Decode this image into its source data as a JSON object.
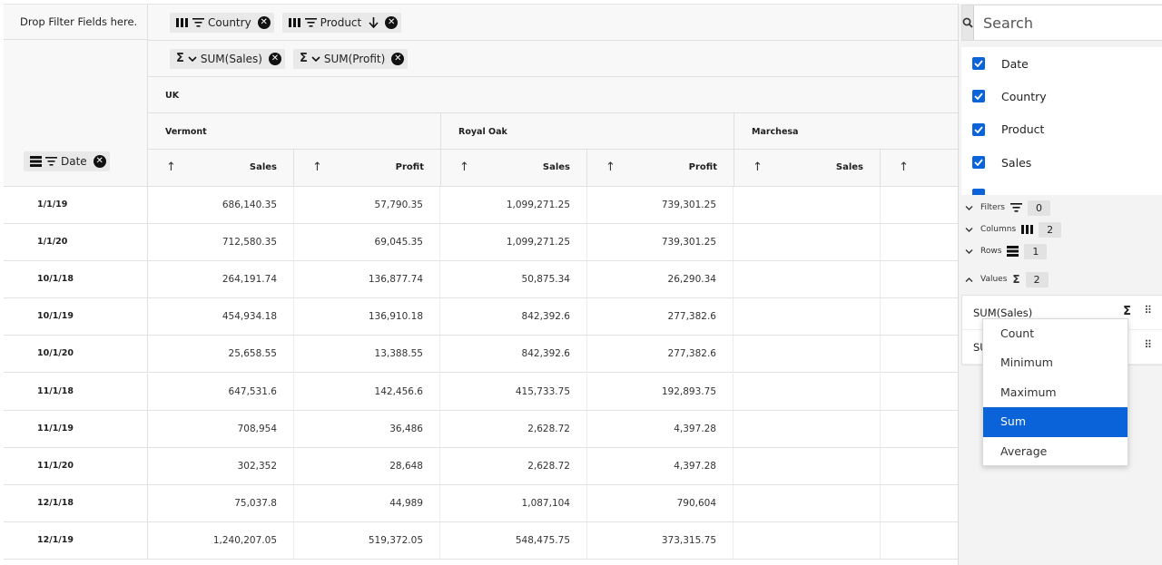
{
  "grid": {
    "filter_drop_text": "Drop Filter Fields here.",
    "column_chips": [
      {
        "label": "Country",
        "sort_icon": "none"
      },
      {
        "label": "Product",
        "sort_icon": "arrow-down-icon"
      }
    ],
    "value_chips": [
      {
        "label": "SUM(Sales)"
      },
      {
        "label": "SUM(Profit)"
      }
    ],
    "row_chip": {
      "label": "Date"
    },
    "country_header": "UK",
    "product_headers": [
      "Vermont",
      "Royal Oak",
      "Marchesa"
    ],
    "measure_headers": [
      "Sales",
      "Profit",
      "Sales",
      "Profit",
      "Sales",
      ""
    ],
    "sort_arrow_glyph": "↑",
    "rows": [
      {
        "date": "1/1/19",
        "values": [
          "686,140.35",
          "57,790.35",
          "1,099,271.25",
          "739,301.25",
          "",
          ""
        ]
      },
      {
        "date": "1/1/20",
        "values": [
          "712,580.35",
          "69,045.35",
          "1,099,271.25",
          "739,301.25",
          "",
          ""
        ]
      },
      {
        "date": "10/1/18",
        "values": [
          "264,191.74",
          "136,877.74",
          "50,875.34",
          "26,290.34",
          "",
          ""
        ]
      },
      {
        "date": "10/1/19",
        "values": [
          "454,934.18",
          "136,910.18",
          "842,392.6",
          "277,382.6",
          "",
          ""
        ]
      },
      {
        "date": "10/1/20",
        "values": [
          "25,658.55",
          "13,388.55",
          "842,392.6",
          "277,382.6",
          "",
          ""
        ]
      },
      {
        "date": "11/1/18",
        "values": [
          "647,531.6",
          "142,456.6",
          "415,733.75",
          "192,893.75",
          "",
          ""
        ]
      },
      {
        "date": "11/1/19",
        "values": [
          "708,954",
          "36,486",
          "2,628.72",
          "4,397.28",
          "",
          ""
        ]
      },
      {
        "date": "11/1/20",
        "values": [
          "302,352",
          "28,648",
          "2,628.72",
          "4,397.28",
          "",
          ""
        ]
      },
      {
        "date": "12/1/18",
        "values": [
          "75,037.8",
          "44,989",
          "1,087,104",
          "790,604",
          "",
          ""
        ]
      },
      {
        "date": "12/1/19",
        "values": [
          "1,240,207.05",
          "519,372.05",
          "548,475.75",
          "373,315.75",
          "",
          ""
        ]
      }
    ]
  },
  "chooser": {
    "search_placeholder": "Search",
    "fields": [
      {
        "label": "Date",
        "checked": true
      },
      {
        "label": "Country",
        "checked": true
      },
      {
        "label": "Product",
        "checked": true
      },
      {
        "label": "Sales",
        "checked": true
      }
    ],
    "sections": [
      {
        "label": "Filters",
        "count": "0",
        "icon": "filter-icon",
        "expanded": false
      },
      {
        "label": "Columns",
        "count": "2",
        "icon": "columns-icon",
        "expanded": false
      },
      {
        "label": "Rows",
        "count": "1",
        "icon": "rows-icon",
        "expanded": false
      },
      {
        "label": "Values",
        "count": "2",
        "icon": "sigma-icon",
        "expanded": true
      }
    ],
    "values": [
      {
        "label": "SUM(Sales)"
      },
      {
        "label": "SU"
      }
    ]
  },
  "aggregation_menu": {
    "options": [
      "Count",
      "Minimum",
      "Maximum",
      "Sum",
      "Average"
    ],
    "selected": "Sum"
  },
  "colors": {
    "accent": "#0a63d8",
    "header_bg": "#f8f8f8",
    "chip_bg": "#e9e9e9"
  }
}
